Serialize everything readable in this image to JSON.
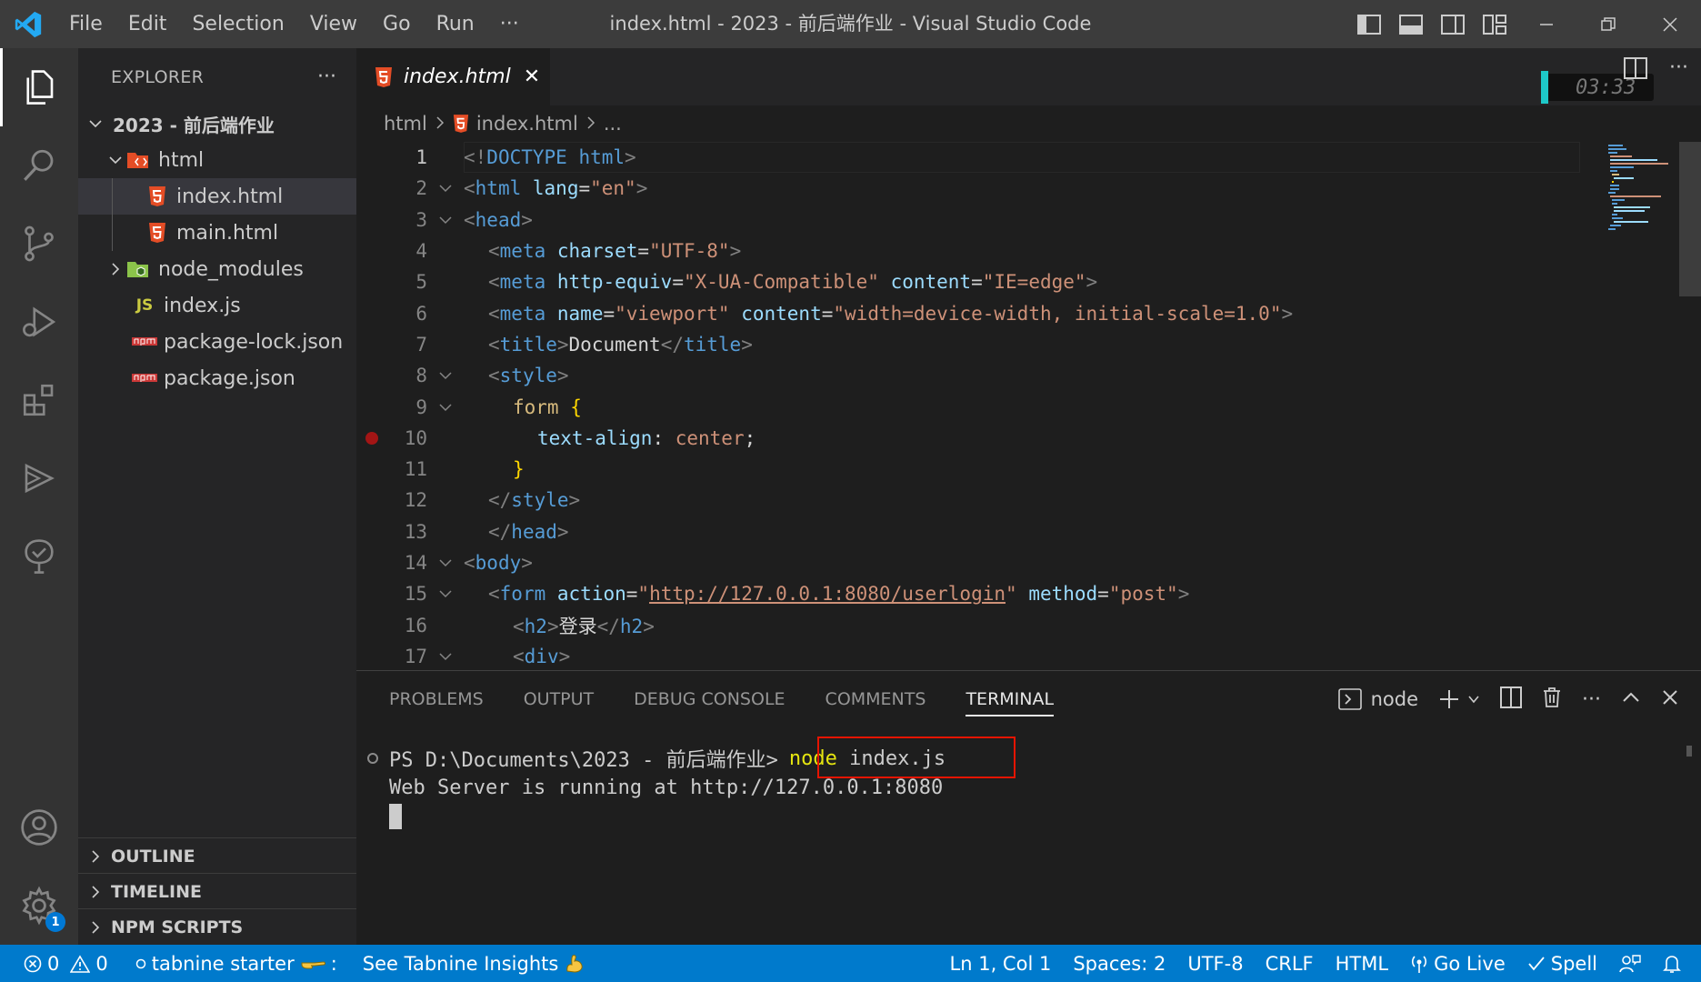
{
  "window": {
    "title": "index.html - 2023 - 前后端作业 - Visual Studio Code"
  },
  "menu": [
    "File",
    "Edit",
    "Selection",
    "View",
    "Go",
    "Run",
    "···"
  ],
  "colors": {
    "titlebar": "#3c3c3c",
    "activitybar": "#333333",
    "sidebar": "#252526",
    "editor": "#1e1e1e",
    "statusbar": "#007acc",
    "html_icon": "#e44d26",
    "highlight_box": "#e51400"
  },
  "explorer": {
    "title": "EXPLORER",
    "more": "···",
    "root": "2023 - 前后端作业",
    "items": [
      {
        "label": "html",
        "type": "folder-open",
        "icon": "html-folder-icon"
      },
      {
        "label": "index.html",
        "type": "file",
        "icon": "html-file-icon"
      },
      {
        "label": "main.html",
        "type": "file",
        "icon": "html-file-icon"
      },
      {
        "label": "node_modules",
        "type": "folder",
        "icon": "node-folder-icon"
      },
      {
        "label": "index.js",
        "type": "file",
        "icon": "js-file-icon",
        "icon_text": "JS"
      },
      {
        "label": "package-lock.json",
        "type": "file",
        "icon": "npm-file-icon"
      },
      {
        "label": "package.json",
        "type": "file",
        "icon": "npm-file-icon"
      }
    ],
    "sections": [
      "OUTLINE",
      "TIMELINE",
      "NPM SCRIPTS"
    ]
  },
  "editor": {
    "tab_label": "index.html",
    "tab_close": "✕",
    "timer": "03:33",
    "breadcrumb": [
      "html",
      "index.html",
      "..."
    ],
    "line_numbers": [
      "1",
      "2",
      "3",
      "4",
      "5",
      "6",
      "7",
      "8",
      "9",
      "10",
      "11",
      "12",
      "13",
      "14",
      "15",
      "16",
      "17"
    ],
    "lines": [
      "<!DOCTYPE html>",
      "<html lang=\"en\">",
      "<head>",
      "<meta charset=\"UTF-8\">",
      "<meta http-equiv=\"X-UA-Compatible\" content=\"IE=edge\">",
      "<meta name=\"viewport\" content=\"width=device-width, initial-scale=1.0\">",
      "<title>Document</title>",
      "<style>",
      "form {",
      "text-align: center;",
      "}",
      "</style>",
      "</head>",
      "<body>",
      "<form action=\"http://127.0.0.1:8080/userlogin\" method=\"post\">",
      "<h2>登录</h2>",
      "<div>"
    ]
  },
  "panel": {
    "tabs": [
      "PROBLEMS",
      "OUTPUT",
      "DEBUG CONSOLE",
      "COMMENTS",
      "TERMINAL"
    ],
    "active_tab": "TERMINAL",
    "terminal_name": "node",
    "more": "···",
    "terminal": {
      "prompt": "PS D:\\Documents\\2023 - 前后端作业>",
      "cmd_node": "node",
      "cmd_arg": " index.js",
      "output": "Web Server is running at http://127.0.0.1:8080"
    }
  },
  "statusbar": {
    "errors": "0",
    "warnings": "0",
    "tabnine": "tabnine starter",
    "tabnine_suffix": ":",
    "insights": "See Tabnine Insights",
    "position": "Ln 1, Col 1",
    "spaces": "Spaces: 2",
    "encoding": "UTF-8",
    "eol": "CRLF",
    "language": "HTML",
    "golive": "Go Live",
    "spell": "Spell",
    "settings_badge": "1"
  }
}
